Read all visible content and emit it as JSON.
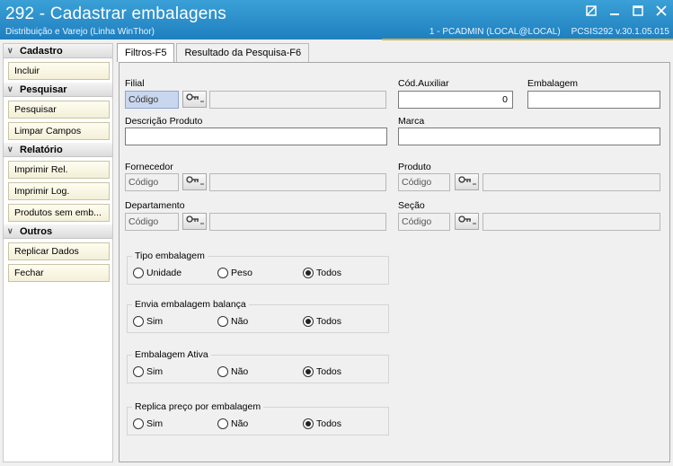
{
  "window": {
    "title": "292 - Cadastrar embalagens",
    "subtitle": "Distribuição e Varejo (Linha WinThor)",
    "user": "1 - PCADMIN (LOCAL@LOCAL)",
    "version": "PCSIS292  v.30.1.05.015"
  },
  "sidebar": {
    "cadastro": {
      "title": "Cadastro",
      "items": [
        "Incluir"
      ]
    },
    "pesquisar": {
      "title": "Pesquisar",
      "items": [
        "Pesquisar",
        "Limpar Campos"
      ]
    },
    "relatorio": {
      "title": "Relatório",
      "items": [
        "Imprimir Rel.",
        "Imprimir Log.",
        "Produtos sem emb..."
      ]
    },
    "outros": {
      "title": "Outros",
      "items": [
        "Replicar Dados",
        "Fechar"
      ]
    }
  },
  "tabs": [
    "Filtros-F5",
    "Resultado da Pesquisa-F6"
  ],
  "filters": {
    "filial_label": "Filial",
    "codigo_placeholder": "Código",
    "cod_aux_label": "Cód.Auxiliar",
    "cod_aux_value": "0",
    "embalagem_label": "Embalagem",
    "descricao_label": "Descrição Produto",
    "marca_label": "Marca",
    "fornecedor_label": "Fornecedor",
    "produto_label": "Produto",
    "departamento_label": "Departamento",
    "secao_label": "Seção"
  },
  "radio_groups": [
    {
      "title": "Tipo embalagem",
      "options": [
        "Unidade",
        "Peso",
        "Todos"
      ],
      "selected": 2
    },
    {
      "title": "Envia embalagem balança",
      "options": [
        "Sim",
        "Não",
        "Todos"
      ],
      "selected": 2
    },
    {
      "title": "Embalagem Ativa",
      "options": [
        "Sim",
        "Não",
        "Todos"
      ],
      "selected": 2
    },
    {
      "title": "Replica preço por embalagem",
      "options": [
        "Sim",
        "Não",
        "Todos"
      ],
      "selected": 2
    }
  ]
}
